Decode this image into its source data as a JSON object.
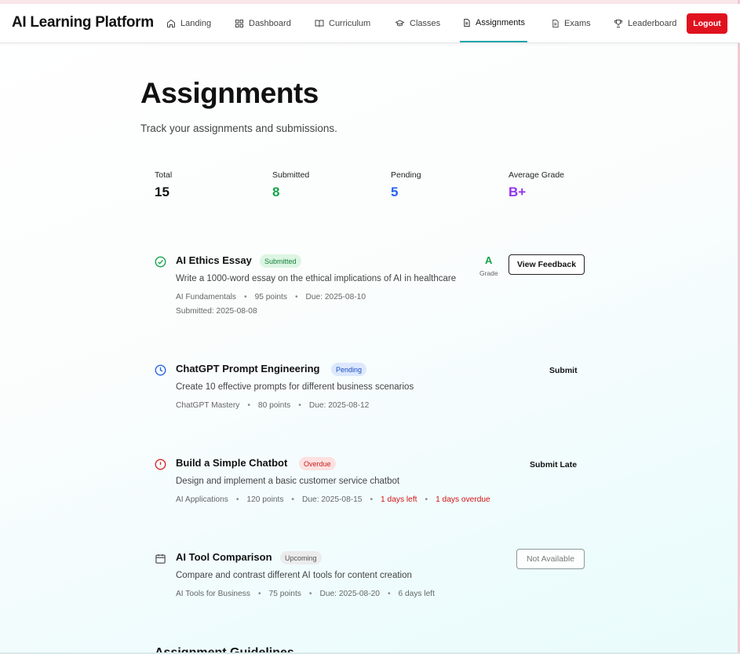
{
  "nav": {
    "brand": "AI Learning Platform",
    "items": [
      {
        "label": "Landing",
        "icon": "home-icon"
      },
      {
        "label": "Dashboard",
        "icon": "dashboard-icon"
      },
      {
        "label": "Curriculum",
        "icon": "book-icon"
      },
      {
        "label": "Classes",
        "icon": "graduation-cap-icon"
      },
      {
        "label": "Assignments",
        "icon": "document-icon",
        "active": true
      },
      {
        "label": "Exams",
        "icon": "document-icon"
      },
      {
        "label": "Leaderboard",
        "icon": "trophy-icon"
      }
    ],
    "logout": "Logout"
  },
  "page": {
    "title": "Assignments",
    "subtitle": "Track your assignments and submissions."
  },
  "stats": [
    {
      "label": "Total",
      "value": "15",
      "color": "#111111"
    },
    {
      "label": "Submitted",
      "value": "8",
      "color": "#16a34a"
    },
    {
      "label": "Pending",
      "value": "5",
      "color": "#2563eb"
    },
    {
      "label": "Average Grade",
      "value": "B+",
      "color": "#9333ea"
    }
  ],
  "assignments": [
    {
      "title": "AI Ethics Essay",
      "status": "Submitted",
      "status_icon": "check-circle-icon",
      "description": "Write a 1000-word essay on the ethical implications of AI in healthcare",
      "course": "AI Fundamentals",
      "points": "95 points",
      "due": "Due: 2025-08-10",
      "submitted": "Submitted: 2025-08-08",
      "grade": "A",
      "grade_label": "Grade",
      "action": "View Feedback"
    },
    {
      "title": "ChatGPT Prompt Engineering",
      "status": "Pending",
      "status_icon": "clock-icon",
      "description": "Create 10 effective prompts for different business scenarios",
      "course": "ChatGPT Mastery",
      "points": "80 points",
      "due": "Due: 2025-08-12",
      "action": "Submit"
    },
    {
      "title": "Build a Simple Chatbot",
      "status": "Overdue",
      "status_icon": "alert-circle-icon",
      "description": "Design and implement a basic customer service chatbot",
      "course": "AI Applications",
      "points": "120 points",
      "due": "Due: 2025-08-15",
      "days_left": "1 days left",
      "overdue": "1 days overdue",
      "action": "Submit Late"
    },
    {
      "title": "AI Tool Comparison",
      "status": "Upcoming",
      "status_icon": "calendar-icon",
      "description": "Compare and contrast different AI tools for content creation",
      "course": "AI Tools for Business",
      "points": "75 points",
      "due": "Due: 2025-08-20",
      "days_left": "6 days left",
      "action": "Not Available"
    }
  ],
  "guidelines_heading": "Assignment Guidelines"
}
